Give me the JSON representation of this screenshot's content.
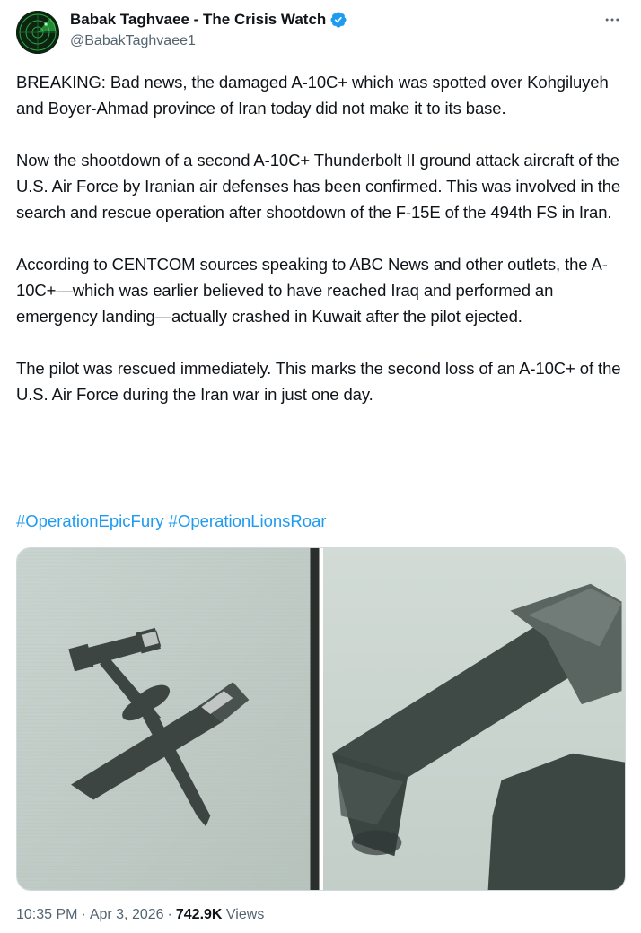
{
  "author": {
    "display_name": "Babak Taghvaee - The Crisis Watch",
    "handle": "@BabakTaghvaee1",
    "avatar_icon": "radar-avatar",
    "verified_icon": "verified-badge-icon"
  },
  "tweet": {
    "paragraphs": [
      "BREAKING: Bad news, the damaged A-10C+ which was spotted over Kohgiluyeh and Boyer-Ahmad province of Iran today did not make it to its base.",
      "Now the shootdown of a second A-10C+ Thunderbolt II ground attack aircraft of the U.S. Air Force by Iranian air defenses has been confirmed. This was involved in the search and rescue operation after shootdown of the F-15E of the 494th FS in Iran.",
      "According to CENTCOM sources speaking to ABC News and other outlets, the A-10C+—which was earlier believed to have reached Iraq and performed an emergency landing—actually crashed in Kuwait after the pilot ejected.",
      "The pilot was rescued immediately. This marks the second loss of an A-10C+ of the U.S. Air Force during the Iran war in just one day."
    ],
    "hashtags": [
      "#OperationEpicFury",
      "#OperationLionsRoar"
    ]
  },
  "media": {
    "photos": [
      {
        "name": "a10-aircraft-photo"
      },
      {
        "name": "a10-tail-closeup-photo"
      }
    ]
  },
  "meta": {
    "time": "10:35 PM",
    "separator": "·",
    "date": "Apr 3, 2026",
    "views_count": "742.9K",
    "views_label": "Views"
  },
  "colors": {
    "accent": "#1d9bf0",
    "text": "#0f1419",
    "secondary": "#536471"
  }
}
